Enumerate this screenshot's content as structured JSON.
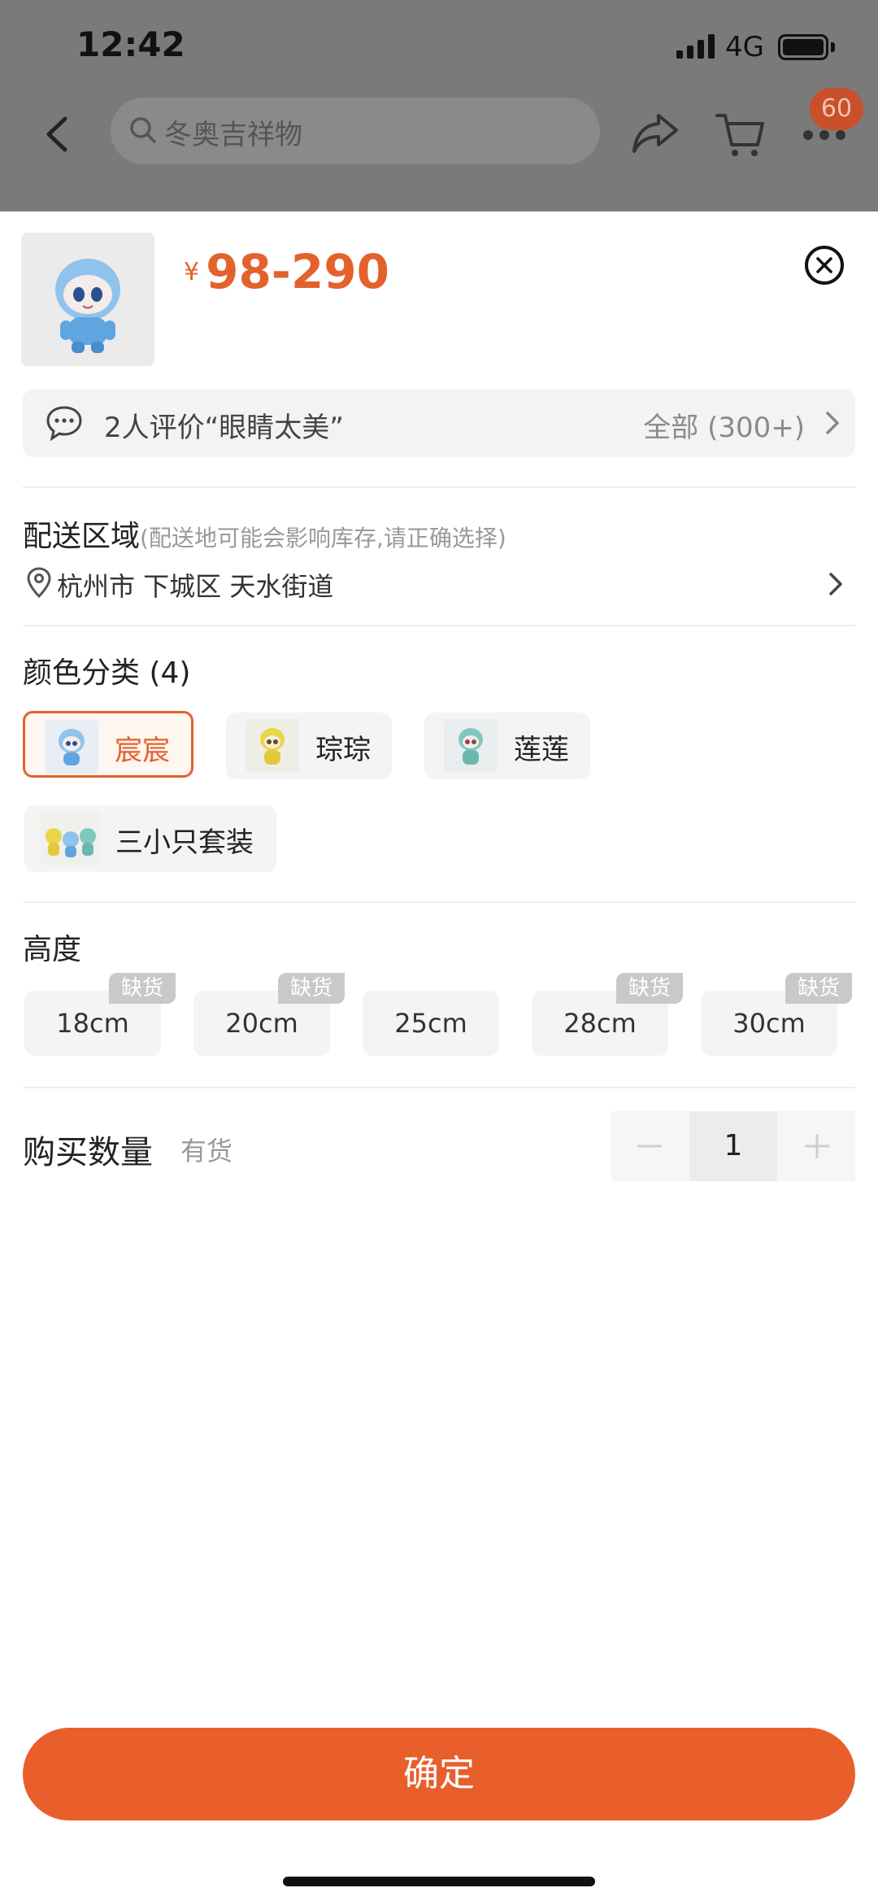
{
  "status_bar": {
    "time": "12:42",
    "network": "4G"
  },
  "nav": {
    "search_placeholder": "冬奥吉祥物",
    "message_count": "60"
  },
  "product": {
    "currency": "¥",
    "price": "98-290"
  },
  "reviews": {
    "summary": "2人评价“眼睛太美”",
    "all": "全部 (300+)"
  },
  "delivery": {
    "title": "配送区域",
    "hint": "(配送地可能会影响库存,请正确选择)",
    "address": "杭州市 下城区 天水街道"
  },
  "color": {
    "title": "颜色分类 (4)",
    "options": [
      {
        "label": "宸宸",
        "selected": true
      },
      {
        "label": "琮琮",
        "selected": false
      },
      {
        "label": "莲莲",
        "selected": false
      },
      {
        "label": "三小只套装",
        "selected": false
      }
    ]
  },
  "height": {
    "title": "高度",
    "out_of_stock_label": "缺货",
    "options": [
      {
        "label": "18cm",
        "out_of_stock": true
      },
      {
        "label": "20cm",
        "out_of_stock": true
      },
      {
        "label": "25cm",
        "out_of_stock": false
      },
      {
        "label": "28cm",
        "out_of_stock": true
      },
      {
        "label": "30cm",
        "out_of_stock": true
      }
    ]
  },
  "quantity": {
    "title": "购买数量",
    "stock": "有货",
    "value": "1"
  },
  "confirm_label": "确定",
  "colors": {
    "accent": "#e85f2c",
    "price": "#e3622c"
  }
}
